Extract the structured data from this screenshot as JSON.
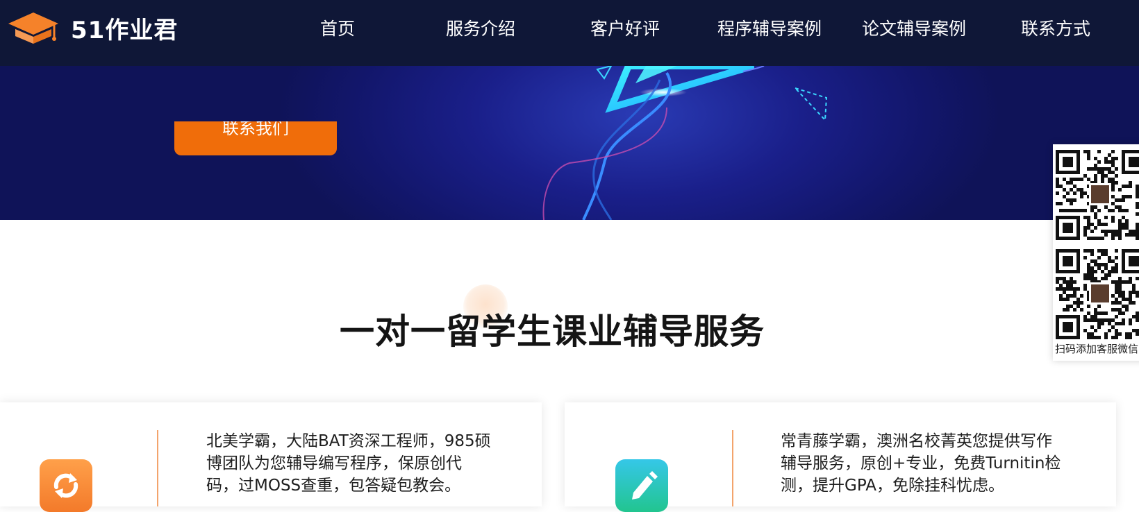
{
  "header": {
    "logo_text": "51作业君",
    "nav": [
      "首页",
      "服务介绍",
      "客户好评",
      "程序辅导案例",
      "论文辅导案例",
      "联系方式"
    ]
  },
  "hero": {
    "contact_button": "联系我们"
  },
  "section": {
    "title": "一对一留学生课业辅导服务"
  },
  "cards": [
    {
      "icon": "refresh-icon",
      "lines": [
        "北美学霸，大陆BAT资深工程师，985硕",
        "博团队为您辅导编写程序，保原创代",
        "码，过MOSS查重，包答疑包教会。"
      ]
    },
    {
      "icon": "pencil-icon",
      "lines": [
        "常青藤学霸，澳洲名校菁英您提供写作",
        "辅导服务，原创+专业，免费Turnitin检",
        "测，提升GPA，免除挂科忧虑。"
      ]
    }
  ],
  "qr_panel": {
    "caption": "扫码添加客服微信"
  },
  "colors": {
    "header_bg": "#0f1737",
    "accent_orange": "#f06d0a",
    "hero_bg": "#12166a"
  }
}
